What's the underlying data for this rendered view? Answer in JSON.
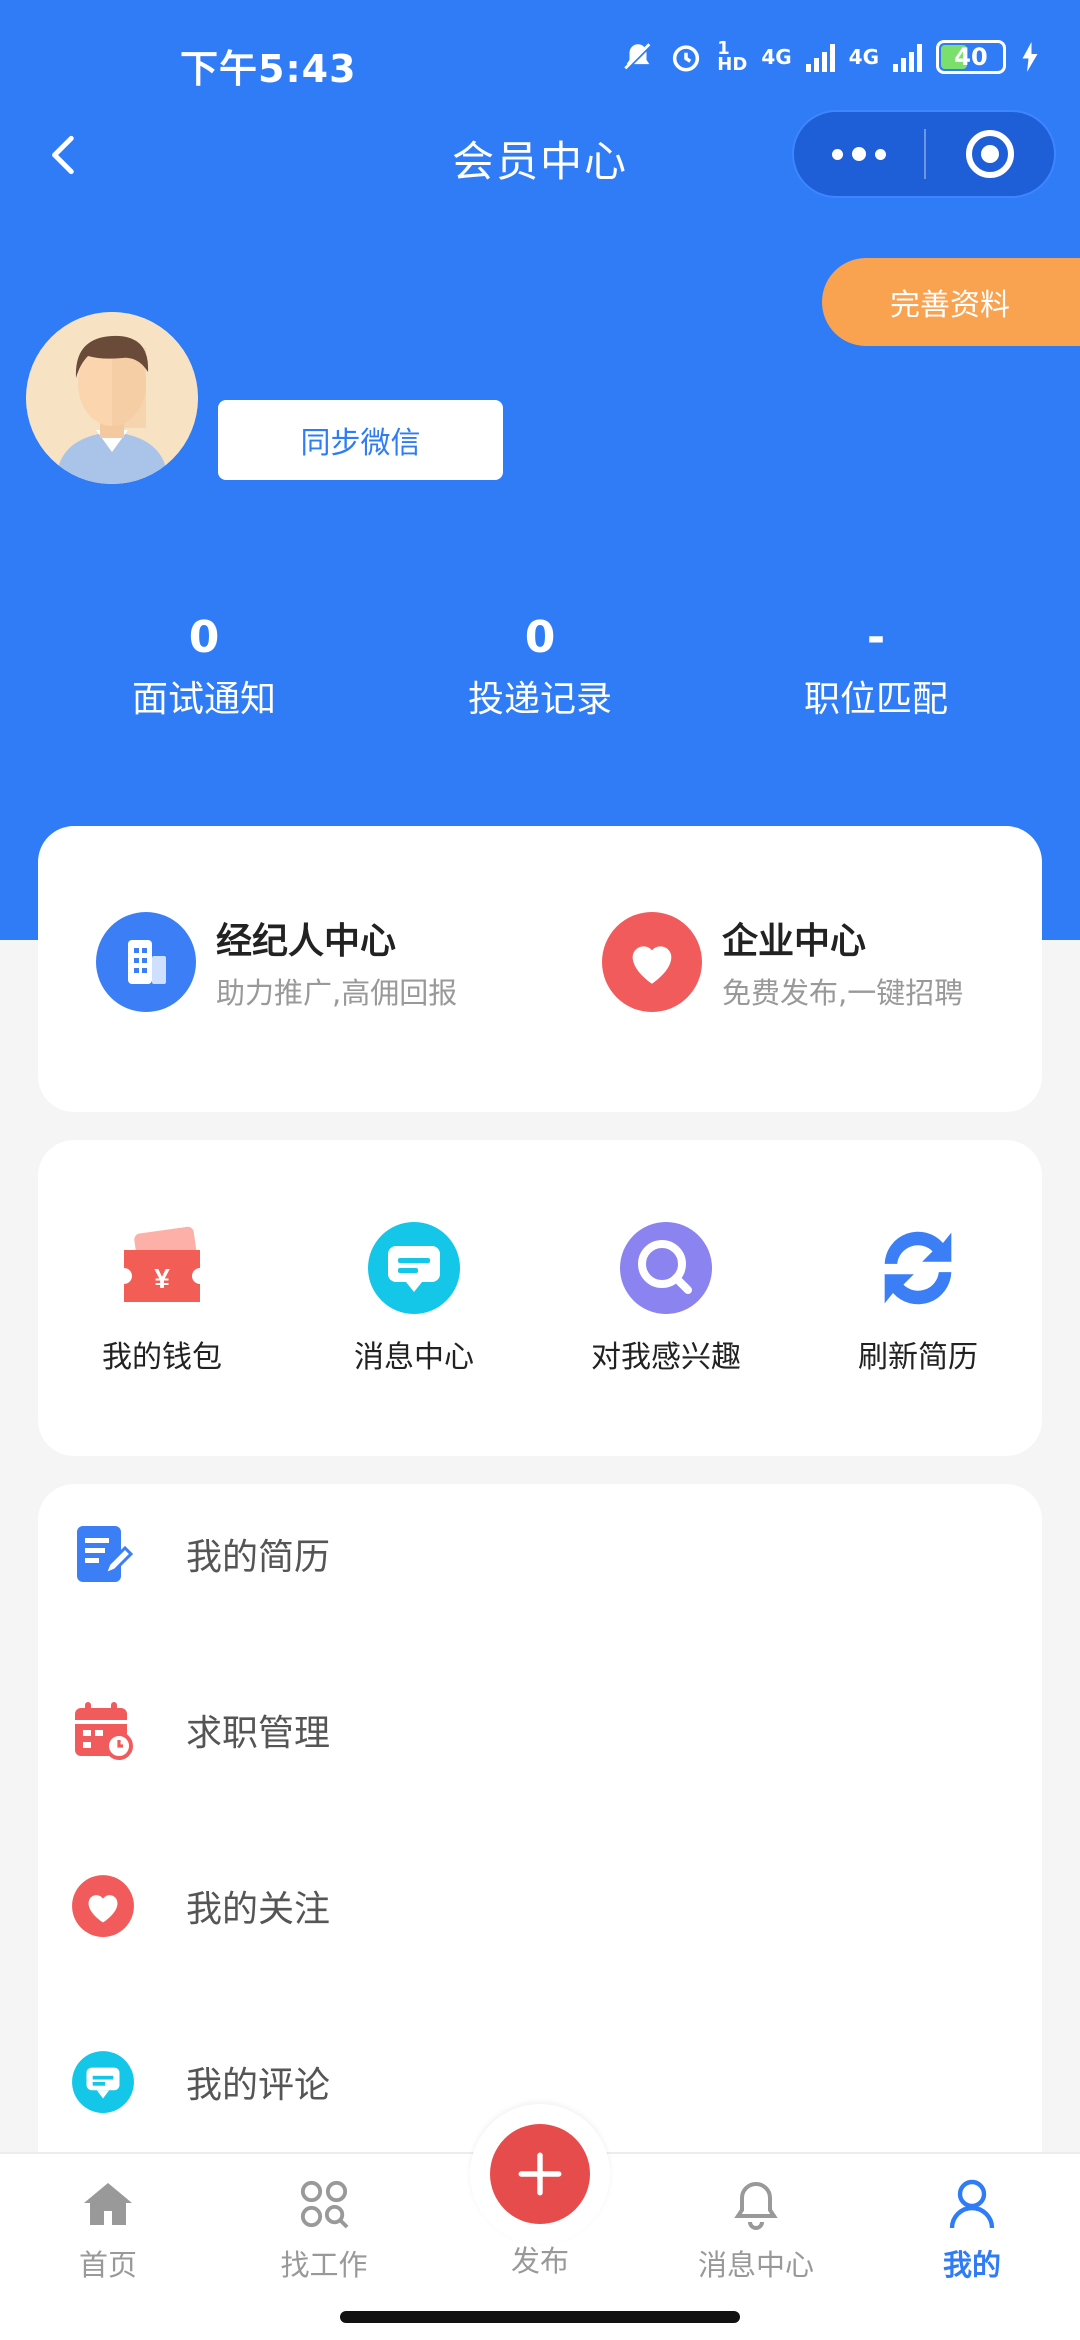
{
  "status_bar": {
    "time": "下午5:43",
    "network": "4G",
    "battery": "40"
  },
  "nav": {
    "title": "会员中心"
  },
  "profile": {
    "complete_label": "完善资料",
    "sync_label": "同步微信"
  },
  "stats": [
    {
      "value": "0",
      "label": "面试通知"
    },
    {
      "value": "0",
      "label": "投递记录"
    },
    {
      "value": "-",
      "label": "职位匹配"
    }
  ],
  "portals": [
    {
      "title": "经纪人中心",
      "subtitle": "助力推广,高佣回报",
      "icon": "building-icon",
      "color": "#3b7ef5"
    },
    {
      "title": "企业中心",
      "subtitle": "免费发布,一键招聘",
      "icon": "heart-icon",
      "color": "#f15b5b"
    }
  ],
  "quick_actions": [
    {
      "label": "我的钱包",
      "icon": "wallet-icon"
    },
    {
      "label": "消息中心",
      "icon": "message-icon"
    },
    {
      "label": "对我感兴趣",
      "icon": "search-icon"
    },
    {
      "label": "刷新简历",
      "icon": "refresh-icon"
    }
  ],
  "menu": [
    {
      "label": "我的简历",
      "icon": "resume-icon"
    },
    {
      "label": "求职管理",
      "icon": "calendar-icon"
    },
    {
      "label": "我的关注",
      "icon": "heart-icon"
    },
    {
      "label": "我的评论",
      "icon": "comment-icon"
    }
  ],
  "tabbar": {
    "items": [
      {
        "label": "首页",
        "icon": "home-icon"
      },
      {
        "label": "找工作",
        "icon": "grid-search-icon"
      },
      {
        "label": "发布",
        "icon": "plus-icon"
      },
      {
        "label": "消息中心",
        "icon": "bell-icon"
      },
      {
        "label": "我的",
        "icon": "user-icon"
      }
    ],
    "active": "我的"
  },
  "colors": {
    "primary": "#2f7cf6",
    "accent_orange": "#f9a24f",
    "accent_red": "#e74c4c"
  }
}
